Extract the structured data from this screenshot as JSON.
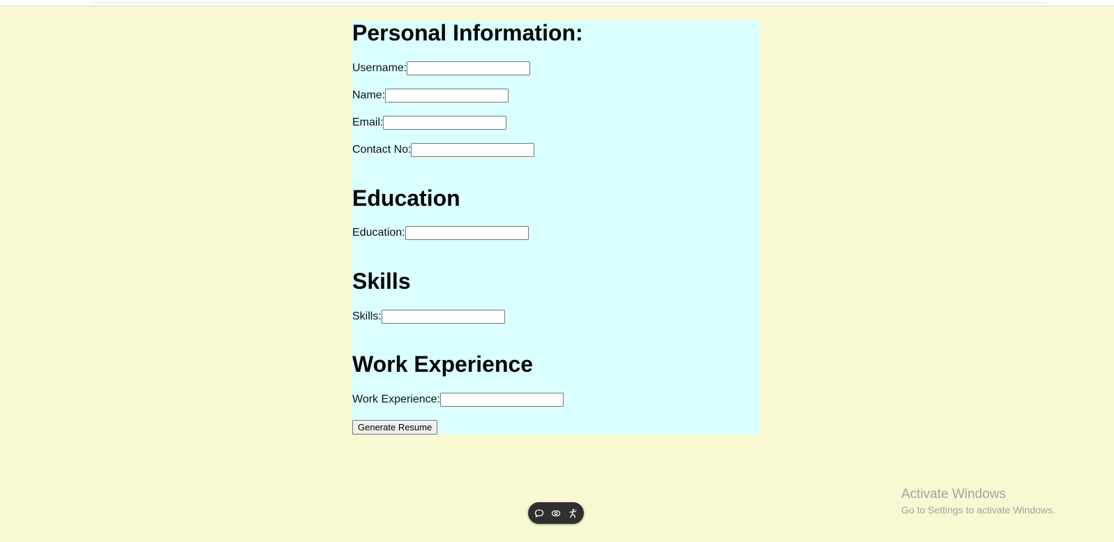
{
  "form": {
    "personal_title": "Personal Information:",
    "username_label": "Username:",
    "username_value": "",
    "name_label": "Name:",
    "name_value": "",
    "email_label": "Email:",
    "email_value": "",
    "contact_label": "Contact No:",
    "contact_value": "",
    "education_title": "Education",
    "education_label": "Education:",
    "education_value": "",
    "skills_title": "Skills",
    "skills_label": "Skills:",
    "skills_value": "",
    "work_title": "Work Experience",
    "work_label": "Work Experience:",
    "work_value": "",
    "generate_button": "Generate Resume"
  },
  "toolbar": {
    "icons": [
      "chat-icon",
      "eye-icon",
      "accessibility-icon"
    ]
  },
  "watermark": {
    "title": "Activate Windows",
    "subtitle": "Go to Settings to activate Windows."
  },
  "colors": {
    "page_background": "#f8f8d2",
    "panel_background": "#dbffff"
  }
}
